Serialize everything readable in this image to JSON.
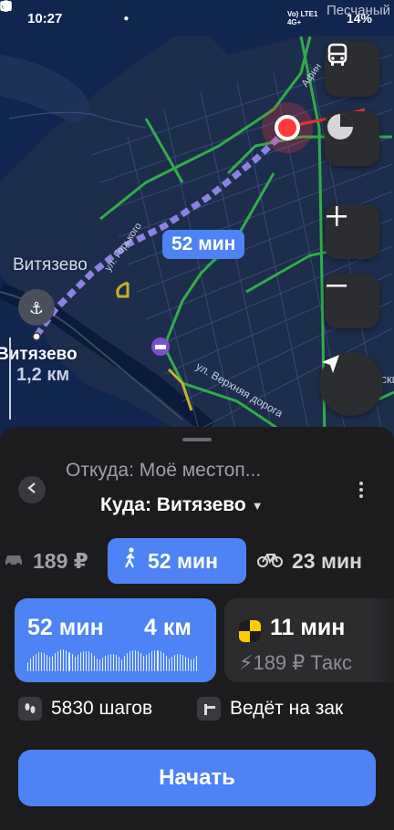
{
  "status_bar": {
    "time": "10:27",
    "network_label": "Vo) LTE1 4G+",
    "battery": "14%",
    "corner_text": "Песчаный"
  },
  "map": {
    "route_time_badge": "52 мин",
    "place_label_1": "Витязево",
    "place_label_2": "Витязево",
    "scale_distance": "1,2 км",
    "street_1": "ул. Горького",
    "street_2": "ул. Верхняя дорога",
    "street_3": "Афин",
    "street_4": "Пионерский",
    "route_color": "#8a83e0",
    "traffic_green": "#2fae4a",
    "traffic_yellow": "#c7b22b",
    "destination_color": "#ff3b3b"
  },
  "route_panel": {
    "from_text": "Откуда: Моё местоп...",
    "to_text": "Куда: Витязево",
    "modes": {
      "car_value": "189 ₽",
      "walk_value": "52 мин",
      "bike_value": "23 мин"
    },
    "walk_card": {
      "time": "52 мин",
      "distance": "4 км"
    },
    "taxi_card": {
      "time": "11 мин",
      "price_line": "189 ₽  Такс"
    },
    "steps_text": "5830 шагов",
    "leads_text": "Ведёт на зак",
    "start_button": "Начать"
  },
  "colors": {
    "accent": "#4d83f5",
    "sheet_bg": "#1c1c1e",
    "map_bg": "#11264f",
    "taxi_yellow": "#ffcc00"
  }
}
